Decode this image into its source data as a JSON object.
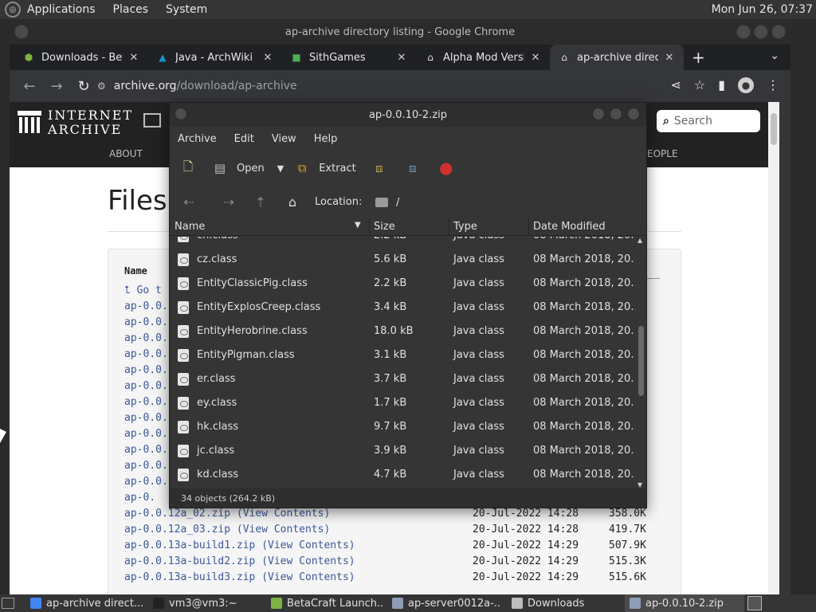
{
  "topbar": {
    "menus": [
      "Applications",
      "Places",
      "System"
    ],
    "clock": "Mon Jun 26, 07:37"
  },
  "chrome": {
    "window_title": "ap-archive directory listing - Google Chrome",
    "tabs": [
      {
        "label": "Downloads - Beta",
        "icon": "betacraft-icon",
        "icon_color": "#7cb342"
      },
      {
        "label": "Java - ArchWiki",
        "icon": "arch-icon",
        "icon_color": "#1793d1"
      },
      {
        "label": "SithGames",
        "icon": "minecraft-block-icon",
        "icon_color": "#4caf50"
      },
      {
        "label": "Alpha Mod Version",
        "icon": "archive-org-icon",
        "icon_color": "#e0e0e0"
      },
      {
        "label": "ap-archive directo",
        "icon": "archive-org-icon",
        "icon_color": "#e0e0e0"
      }
    ],
    "url": {
      "host": "archive.org",
      "path": "/download/ap-archive"
    }
  },
  "web": {
    "logo_line1": "INTERNET",
    "logo_line2": "ARCHIVE",
    "nav_about": "ABOUT",
    "nav_people": "EOPLE",
    "search_placeholder": "Search",
    "files_title": "Files",
    "name_header": "Name",
    "goto_text": "Go t",
    "left_rows": [
      "ap-0.0.",
      "ap-0.0.",
      "ap-0.0.",
      "ap-0.0.",
      "ap-0.0.",
      "ap-0.0.",
      "ap-0.0.",
      "ap-0.0.",
      "ap-0.0.",
      "ap-0.0.",
      "ap-0.0.",
      "ap-0.0.",
      "ap-0."
    ],
    "files": [
      {
        "name": "ap-0.0.12a_02.zip",
        "view": "View Contents",
        "date": "20-Jul-2022 14:28",
        "size": "358.0K"
      },
      {
        "name": "ap-0.0.12a_03.zip",
        "view": "View Contents",
        "date": "20-Jul-2022 14:28",
        "size": "419.7K"
      },
      {
        "name": "ap-0.0.13a-build1.zip",
        "view": "View Contents",
        "date": "20-Jul-2022 14:29",
        "size": "507.9K"
      },
      {
        "name": "ap-0.0.13a-build2.zip",
        "view": "View Contents",
        "date": "20-Jul-2022 14:29",
        "size": "515.3K"
      },
      {
        "name": "ap-0.0.13a-build3.zip",
        "view": "View Contents",
        "date": "20-Jul-2022 14:29",
        "size": "515.6K"
      }
    ]
  },
  "archive_manager": {
    "title": "ap-0.0.10-2.zip",
    "menus": [
      "Archive",
      "Edit",
      "View",
      "Help"
    ],
    "toolbar": {
      "open": "Open",
      "extract": "Extract"
    },
    "location_label": "Location:",
    "location_value": "/",
    "columns": {
      "name": "Name",
      "size": "Size",
      "type": "Type",
      "date": "Date Modified"
    },
    "rows": [
      {
        "name": "cn.class",
        "size": "2.2 kB",
        "type": "Java class",
        "date": "08 March 2018, 20..."
      },
      {
        "name": "cz.class",
        "size": "5.6 kB",
        "type": "Java class",
        "date": "08 March 2018, 20..."
      },
      {
        "name": "EntityClassicPig.class",
        "size": "2.2 kB",
        "type": "Java class",
        "date": "08 March 2018, 20..."
      },
      {
        "name": "EntityExplosCreep.class",
        "size": "3.4 kB",
        "type": "Java class",
        "date": "08 March 2018, 20..."
      },
      {
        "name": "EntityHerobrine.class",
        "size": "18.0 kB",
        "type": "Java class",
        "date": "08 March 2018, 20..."
      },
      {
        "name": "EntityPigman.class",
        "size": "3.1 kB",
        "type": "Java class",
        "date": "08 March 2018, 20..."
      },
      {
        "name": "er.class",
        "size": "3.7 kB",
        "type": "Java class",
        "date": "08 March 2018, 20..."
      },
      {
        "name": "ey.class",
        "size": "1.7 kB",
        "type": "Java class",
        "date": "08 March 2018, 20..."
      },
      {
        "name": "hk.class",
        "size": "9.7 kB",
        "type": "Java class",
        "date": "08 March 2018, 20..."
      },
      {
        "name": "jc.class",
        "size": "3.9 kB",
        "type": "Java class",
        "date": "08 March 2018, 20..."
      },
      {
        "name": "kd.class",
        "size": "4.7 kB",
        "type": "Java class",
        "date": "08 March 2018, 20..."
      }
    ],
    "status": "34 objects (264.2 kB)"
  },
  "taskbar": {
    "items": [
      {
        "label": "ap-archive direct...",
        "icon": "chrome-icon",
        "icon_color": "#4285f4"
      },
      {
        "label": "vm3@vm3:~",
        "icon": "terminal-icon",
        "icon_color": "#222222"
      },
      {
        "label": "BetaCraft Launch...",
        "icon": "betacraft-icon",
        "icon_color": "#7cb342"
      },
      {
        "label": "ap-server0012a-...",
        "icon": "archive-manager-icon",
        "icon_color": "#8d9db6"
      },
      {
        "label": "Downloads",
        "icon": "folder-icon",
        "icon_color": "#bdbdbd"
      },
      {
        "label": "ap-0.0.10-2.zip",
        "icon": "archive-manager-icon",
        "icon_color": "#8d9db6"
      }
    ]
  }
}
